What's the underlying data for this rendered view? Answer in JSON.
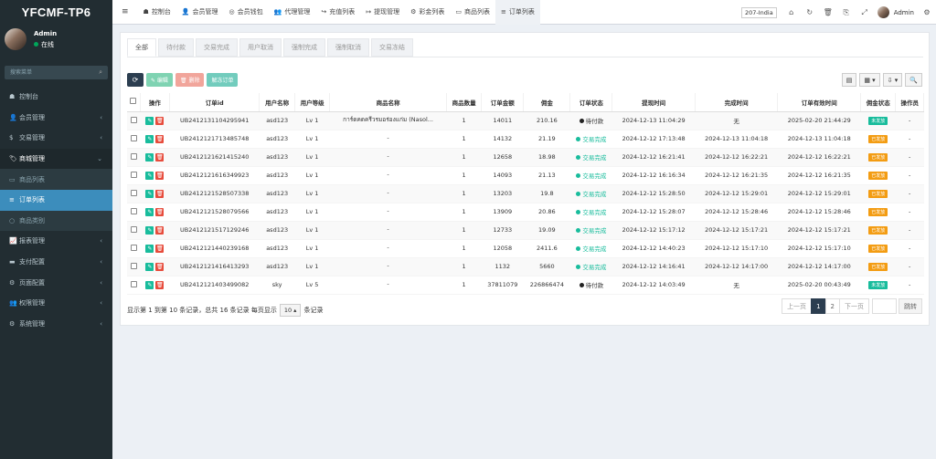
{
  "sidebar": {
    "logo": "YFCMF-TP6",
    "user": {
      "name": "Admin",
      "status": "在线"
    },
    "search_placeholder": "搜索菜单",
    "menu": [
      {
        "icon": "☗",
        "label": "控制台"
      },
      {
        "icon": "👤",
        "label": "会员管理",
        "arrow": "‹"
      },
      {
        "icon": "$",
        "label": "交易管理",
        "arrow": "‹"
      },
      {
        "icon": "🏷",
        "label": "商城管理",
        "arrow": "⌄"
      }
    ],
    "submenu": [
      {
        "icon": "▭",
        "label": "商品列表"
      },
      {
        "icon": "≡",
        "label": "订单列表"
      },
      {
        "icon": "○",
        "label": "商品类别"
      }
    ],
    "menu2": [
      {
        "icon": "📈",
        "label": "报表管理",
        "arrow": "‹"
      },
      {
        "icon": "▬",
        "label": "支付配置",
        "arrow": "‹"
      },
      {
        "icon": "⚙",
        "label": "页面配置",
        "arrow": "‹"
      },
      {
        "icon": "👥",
        "label": "权限管理",
        "arrow": "‹"
      },
      {
        "icon": "⚙",
        "label": "系统管理",
        "arrow": "‹"
      }
    ]
  },
  "navbar": {
    "menu_icon": "≡",
    "items": [
      {
        "icon": "☗",
        "label": "控制台"
      },
      {
        "icon": "👤",
        "label": "会员管理"
      },
      {
        "icon": "◎",
        "label": "会员钱包"
      },
      {
        "icon": "👥",
        "label": "代理管理"
      },
      {
        "icon": "↪",
        "label": "充值列表"
      },
      {
        "icon": "↦",
        "label": "提现管理"
      },
      {
        "icon": "⚙",
        "label": "彩金列表"
      },
      {
        "icon": "▭",
        "label": "商品列表"
      },
      {
        "icon": "≡",
        "label": "订单列表"
      }
    ],
    "lang": "207-India",
    "right_icons": [
      "⌂",
      "↻",
      "🗑",
      "⎘",
      "⤢"
    ],
    "admin": "Admin",
    "settings_icon": "⚙"
  },
  "tabs": [
    "全部",
    "待付款",
    "交易完成",
    "用户取消",
    "强制完成",
    "强制取消",
    "交易冻结"
  ],
  "toolbar": {
    "refresh": "⟳",
    "edit": "✎ 编辑",
    "delete": "🗑 删除",
    "more": "解冻订单"
  },
  "tools": [
    "▤",
    "▦ ▾",
    "⇩ ▾",
    "🔍"
  ],
  "table": {
    "headers": [
      "",
      "操作",
      "订单id",
      "用户名称",
      "用户等级",
      "商品名称",
      "商品数量",
      "订单金额",
      "佣金",
      "订单状态",
      "提现时间",
      "完成时间",
      "订单有效时间",
      "佣金状态",
      "操作员"
    ],
    "rows": [
      {
        "id": "UB2412131104295941",
        "user": "asd123",
        "level": "Lv 1",
        "product": "การ์ดคดครีวรมอร่องแก่ม (Nasol...",
        "qty": "1",
        "amount": "14011",
        "commission": "210.16",
        "status": "待付款",
        "status_type": "pend",
        "time": "2024-12-13 11:04:29",
        "done": "无",
        "valid": "2025-02-20 21:44:29",
        "cstatus": "未发放",
        "cs_type": "g",
        "operator": "-"
      },
      {
        "id": "UB2412121713485748",
        "user": "asd123",
        "level": "Lv 1",
        "product": "-",
        "qty": "1",
        "amount": "14132",
        "commission": "21.19",
        "status": "交易完成",
        "status_type": "done",
        "time": "2024-12-12 17:13:48",
        "done": "2024-12-13 11:04:18",
        "valid": "2024-12-13 11:04:18",
        "cstatus": "已发放",
        "cs_type": "o",
        "operator": "-"
      },
      {
        "id": "UB2412121621415240",
        "user": "asd123",
        "level": "Lv 1",
        "product": "-",
        "qty": "1",
        "amount": "12658",
        "commission": "18.98",
        "status": "交易完成",
        "status_type": "done",
        "time": "2024-12-12 16:21:41",
        "done": "2024-12-12 16:22:21",
        "valid": "2024-12-12 16:22:21",
        "cstatus": "已发放",
        "cs_type": "o",
        "operator": "-"
      },
      {
        "id": "UB2412121616349923",
        "user": "asd123",
        "level": "Lv 1",
        "product": "-",
        "qty": "1",
        "amount": "14093",
        "commission": "21.13",
        "status": "交易完成",
        "status_type": "done",
        "time": "2024-12-12 16:16:34",
        "done": "2024-12-12 16:21:35",
        "valid": "2024-12-12 16:21:35",
        "cstatus": "已发放",
        "cs_type": "o",
        "operator": "-"
      },
      {
        "id": "UB2412121528507338",
        "user": "asd123",
        "level": "Lv 1",
        "product": "-",
        "qty": "1",
        "amount": "13203",
        "commission": "19.8",
        "status": "交易完成",
        "status_type": "done",
        "time": "2024-12-12 15:28:50",
        "done": "2024-12-12 15:29:01",
        "valid": "2024-12-12 15:29:01",
        "cstatus": "已发放",
        "cs_type": "o",
        "operator": "-"
      },
      {
        "id": "UB2412121528079566",
        "user": "asd123",
        "level": "Lv 1",
        "product": "-",
        "qty": "1",
        "amount": "13909",
        "commission": "20.86",
        "status": "交易完成",
        "status_type": "done",
        "time": "2024-12-12 15:28:07",
        "done": "2024-12-12 15:28:46",
        "valid": "2024-12-12 15:28:46",
        "cstatus": "已发放",
        "cs_type": "o",
        "operator": "-"
      },
      {
        "id": "UB2412121517129246",
        "user": "asd123",
        "level": "Lv 1",
        "product": "-",
        "qty": "1",
        "amount": "12733",
        "commission": "19.09",
        "status": "交易完成",
        "status_type": "done",
        "time": "2024-12-12 15:17:12",
        "done": "2024-12-12 15:17:21",
        "valid": "2024-12-12 15:17:21",
        "cstatus": "已发放",
        "cs_type": "o",
        "operator": "-"
      },
      {
        "id": "UB2412121440239168",
        "user": "asd123",
        "level": "Lv 1",
        "product": "-",
        "qty": "1",
        "amount": "12058",
        "commission": "2411.6",
        "status": "交易完成",
        "status_type": "done",
        "time": "2024-12-12 14:40:23",
        "done": "2024-12-12 15:17:10",
        "valid": "2024-12-12 15:17:10",
        "cstatus": "已发放",
        "cs_type": "o",
        "operator": "-"
      },
      {
        "id": "UB2412121416413293",
        "user": "asd123",
        "level": "Lv 1",
        "product": "-",
        "qty": "1",
        "amount": "1132",
        "commission": "5660",
        "status": "交易完成",
        "status_type": "done",
        "time": "2024-12-12 14:16:41",
        "done": "2024-12-12 14:17:00",
        "valid": "2024-12-12 14:17:00",
        "cstatus": "已发放",
        "cs_type": "o",
        "operator": "-"
      },
      {
        "id": "UB2412121403499082",
        "user": "sky",
        "level": "Lv 5",
        "product": "-",
        "qty": "1",
        "amount": "37811079",
        "commission": "226866474",
        "status": "待付款",
        "status_type": "pend",
        "time": "2024-12-12 14:03:49",
        "done": "无",
        "valid": "2025-02-20 00:43:49",
        "cstatus": "未发放",
        "cs_type": "g",
        "operator": "-"
      }
    ]
  },
  "footer": {
    "summary": "显示第 1 到第 10 条记录，总共 16 条记录 每页显示",
    "page_size": "10 ▴",
    "suffix": "条记录"
  },
  "pager": {
    "prev": "上一页",
    "pages": [
      "1",
      "2"
    ],
    "current": "1",
    "next": "下一页",
    "jump": "跳转"
  }
}
